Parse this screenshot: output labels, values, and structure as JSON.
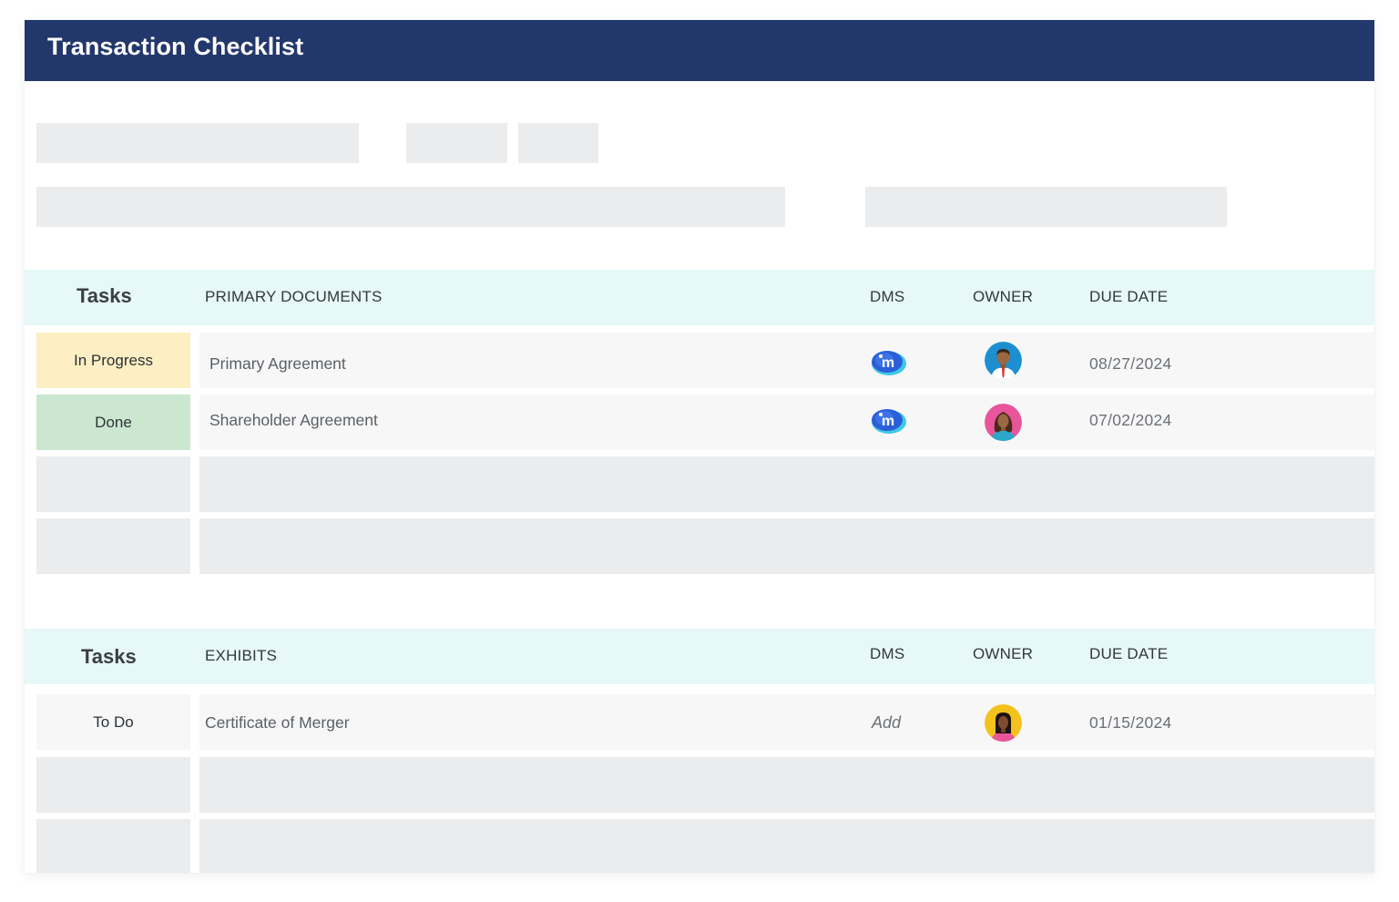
{
  "window": {
    "title": "Transaction Checklist"
  },
  "sections": [
    {
      "tasks_label": "Tasks",
      "columns": {
        "documents": "PRIMARY DOCUMENTS",
        "dms": "DMS",
        "owner": "OWNER",
        "due_date": "DUE DATE"
      },
      "rows": [
        {
          "status": "In Progress",
          "document": "Primary Agreement",
          "dms": "imanage-icon",
          "owner": "man-avatar",
          "due_date": "08/27/2024"
        },
        {
          "status": "Done",
          "document": "Shareholder Agreement",
          "dms": "imanage-icon",
          "owner": "woman-avatar",
          "due_date": "07/02/2024"
        }
      ]
    },
    {
      "tasks_label": "Tasks",
      "columns": {
        "documents": "EXHIBITS",
        "dms": "DMS",
        "owner": "OWNER",
        "due_date": "DUE DATE"
      },
      "rows": [
        {
          "status": "To Do",
          "document": "Certificate of Merger",
          "dms_label": "Add",
          "owner": "woman-avatar",
          "due_date": "01/15/2024"
        }
      ]
    }
  ],
  "colors": {
    "title_bar": "#22376b",
    "header_row": "#e6f8f7",
    "status_in_progress": "#fdefc3",
    "status_done": "#cce7d0",
    "status_todo": "#f7f7f8",
    "placeholder": "#ebecee"
  }
}
